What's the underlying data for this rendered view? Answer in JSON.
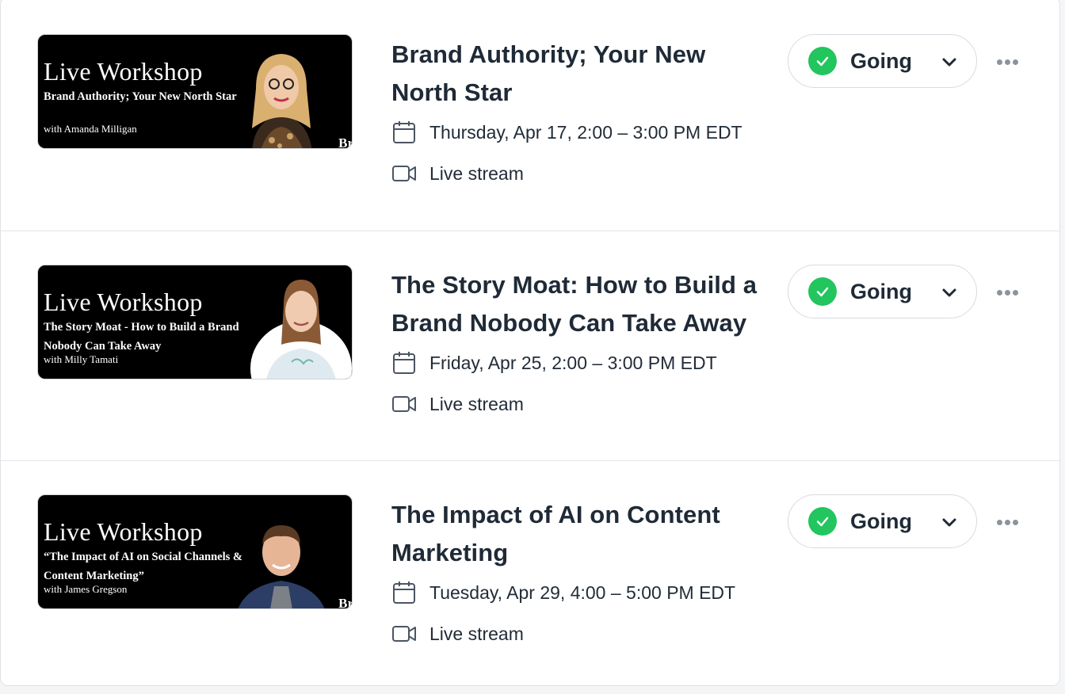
{
  "events": [
    {
      "title": "Brand Authority; Your New North Star",
      "thumbnail": {
        "heading": "Live Workshop",
        "subtitle": "Brand Authority; Your New North Star",
        "host": "with Amanda Milligan",
        "brand": "Br"
      },
      "date": "Thursday, Apr 17, 2:00 – 3:00 PM EDT",
      "location": "Live stream",
      "rsvp_status": "Going"
    },
    {
      "title": "The Story Moat: How to Build a Brand Nobody Can Take Away",
      "thumbnail": {
        "heading": "Live Workshop",
        "subtitle": "The Story Moat - How to Build a Brand Nobody Can Take Away",
        "host": "with Milly Tamati",
        "brand": "Br"
      },
      "date": "Friday, Apr 25, 2:00 – 3:00 PM EDT",
      "location": "Live stream",
      "rsvp_status": "Going"
    },
    {
      "title": "The Impact of AI on Content Marketing",
      "thumbnail": {
        "heading": "Live Workshop",
        "subtitle": "“The Impact of AI on Social Channels & Content Marketing”",
        "host": "with James Gregson",
        "brand": "Br"
      },
      "date": "Tuesday, Apr 29, 4:00 – 5:00 PM EDT",
      "location": "Live stream",
      "rsvp_status": "Going"
    }
  ],
  "icons": {
    "date": "calendar-icon",
    "location": "video-camera-icon",
    "status": "check-circle-icon",
    "dropdown": "chevron-down-icon",
    "menu": "more-horizontal-icon"
  },
  "colors": {
    "going_green": "#22c55e",
    "title_text": "#1f2a37",
    "muted_icon": "#8b939e"
  }
}
